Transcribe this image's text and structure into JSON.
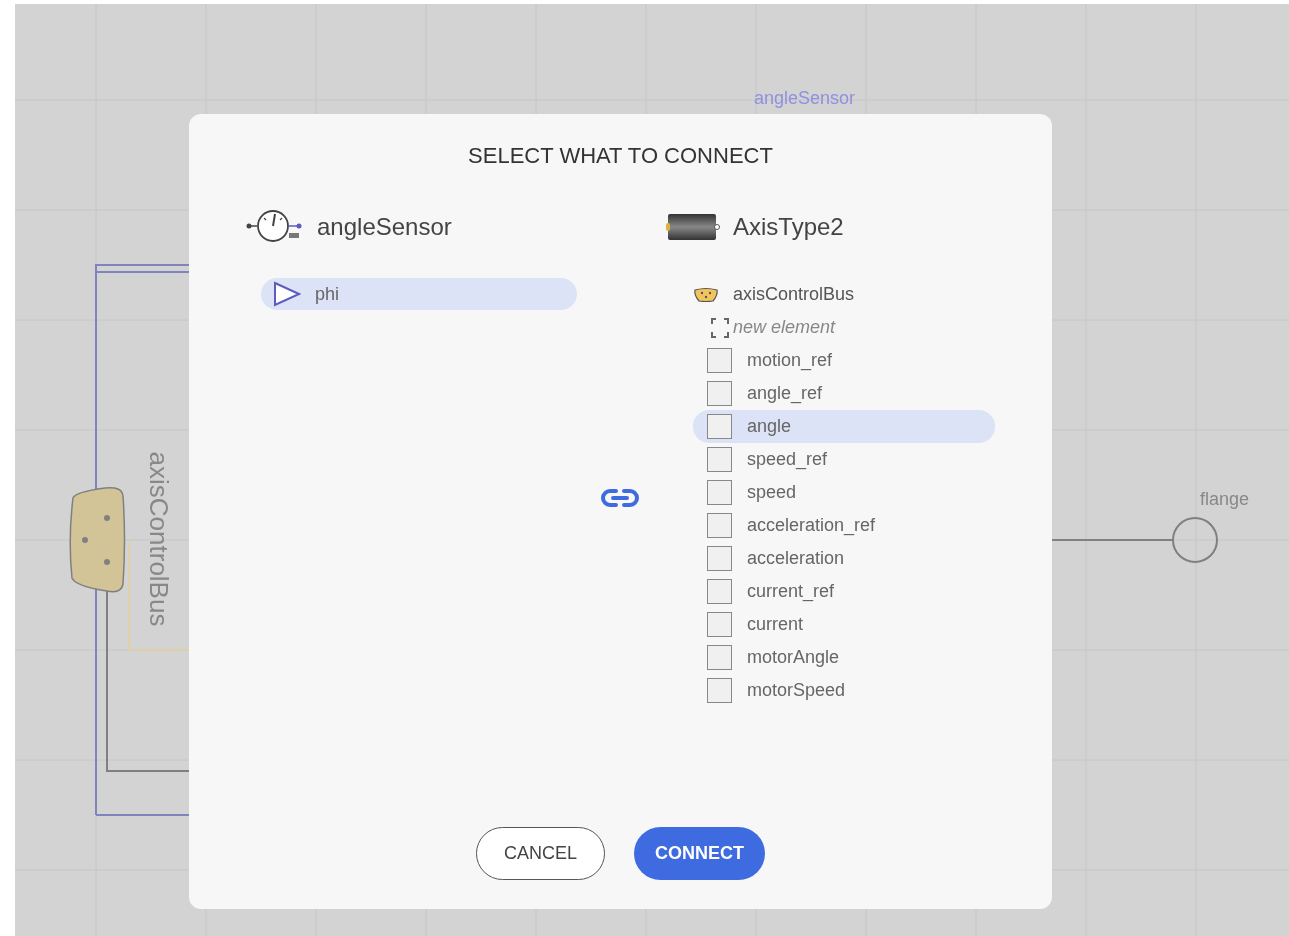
{
  "canvas": {
    "labels": [
      {
        "kind": "instance",
        "text": "angleSensor"
      },
      {
        "kind": "bus",
        "text": "axisControlBus"
      },
      {
        "kind": "port",
        "text": "flange"
      }
    ]
  },
  "dialog": {
    "title": "SELECT WHAT TO CONNECT",
    "source": {
      "name": "angleSensor",
      "ports": [
        {
          "label": "phi",
          "selected": true
        }
      ]
    },
    "target": {
      "name": "AxisType2",
      "bus": "axisControlBus",
      "new_element": {
        "placeholder": "new element"
      },
      "signals": [
        {
          "label": "motion_ref",
          "checked": false,
          "selected": false
        },
        {
          "label": "angle_ref",
          "checked": false,
          "selected": false
        },
        {
          "label": "angle",
          "checked": false,
          "selected": true
        },
        {
          "label": "speed_ref",
          "checked": false,
          "selected": false
        },
        {
          "label": "speed",
          "checked": false,
          "selected": false
        },
        {
          "label": "acceleration_ref",
          "checked": false,
          "selected": false
        },
        {
          "label": "acceleration",
          "checked": false,
          "selected": false
        },
        {
          "label": "current_ref",
          "checked": false,
          "selected": false
        },
        {
          "label": "current",
          "checked": false,
          "selected": false
        },
        {
          "label": "motorAngle",
          "checked": false,
          "selected": false
        },
        {
          "label": "motorSpeed",
          "checked": false,
          "selected": false
        }
      ]
    },
    "buttons": [
      {
        "kind": "secondary",
        "label": "CANCEL"
      },
      {
        "kind": "primary",
        "label": "CONNECT"
      }
    ]
  }
}
